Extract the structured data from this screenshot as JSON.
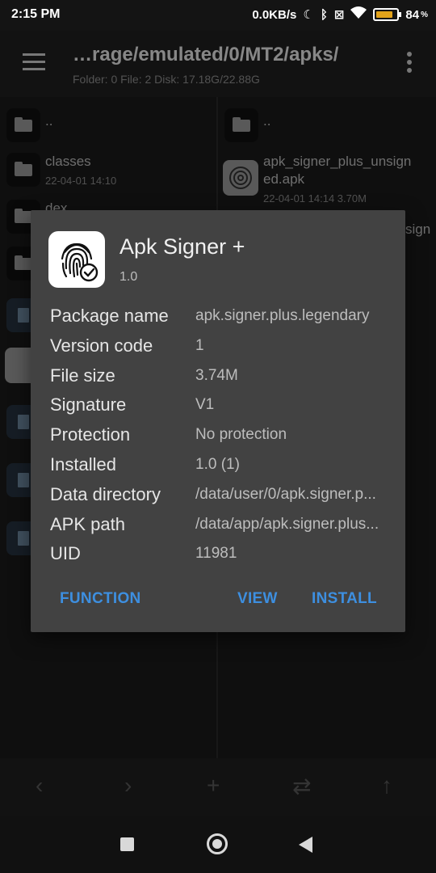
{
  "statusbar": {
    "time": "2:15 PM",
    "net_speed": "0.0KB/s",
    "battery_text": "84",
    "battery_level": 0.84,
    "icons": [
      "moon-icon",
      "bluetooth-icon",
      "sim-icon",
      "wifi-icon",
      "battery-icon"
    ]
  },
  "toolbar": {
    "path": "…rage/emulated/0/MT2/apks/",
    "info": "Folder: 0  File: 2  Disk: 17.18G/22.88G"
  },
  "left_pane": {
    "parent": "..",
    "items": [
      {
        "name": "classes",
        "meta": "22-04-01 14:10"
      },
      {
        "name": "dex",
        "meta": ""
      }
    ]
  },
  "right_pane": {
    "parent": "..",
    "items": [
      {
        "name_line1": "apk_signer_plus_unsign",
        "name_line2": "ed.apk",
        "meta": "22-04-01 14:14  3.70M"
      },
      {
        "name_tail": "sign"
      }
    ]
  },
  "dialog": {
    "app_name": "Apk Signer +",
    "app_version": "1.0",
    "rows": [
      {
        "label": "Package name",
        "value": "apk.signer.plus.legendary"
      },
      {
        "label": "Version code",
        "value": "1"
      },
      {
        "label": "File size",
        "value": "3.74M"
      },
      {
        "label": "Signature",
        "value": "V1"
      },
      {
        "label": "Protection",
        "value": "No protection"
      },
      {
        "label": "Installed",
        "value": "1.0 (1)"
      },
      {
        "label": "Data directory",
        "value": "/data/user/0/apk.signer.p..."
      },
      {
        "label": "APK path",
        "value": "/data/app/apk.signer.plus..."
      },
      {
        "label": "UID",
        "value": "11981"
      }
    ],
    "buttons": {
      "function": "FUNCTION",
      "view": "VIEW",
      "install": "INSTALL"
    },
    "accent": "#3d8fe0"
  },
  "actionbar": {
    "icons": [
      "chevron-left-icon",
      "chevron-right-icon",
      "add-icon",
      "swap-icon",
      "arrow-up-icon"
    ]
  }
}
